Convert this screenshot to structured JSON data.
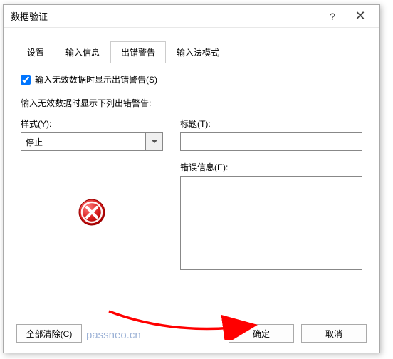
{
  "dialog": {
    "title": "数据验证",
    "tabs": [
      "设置",
      "输入信息",
      "出错警告",
      "输入法模式"
    ],
    "active_tab_index": 2
  },
  "error_tab": {
    "show_alert_label": "输入无效数据时显示出错警告(S)",
    "show_alert_checked": true,
    "section_label": "输入无效数据时显示下列出错警告:",
    "style_label": "样式(Y):",
    "style_value": "停止",
    "title_label": "标题(T):",
    "title_value": "",
    "message_label": "错误信息(E):",
    "message_value": ""
  },
  "buttons": {
    "clear_all": "全部清除(C)",
    "ok": "确定",
    "cancel": "取消"
  },
  "watermark": "passneo.cn"
}
